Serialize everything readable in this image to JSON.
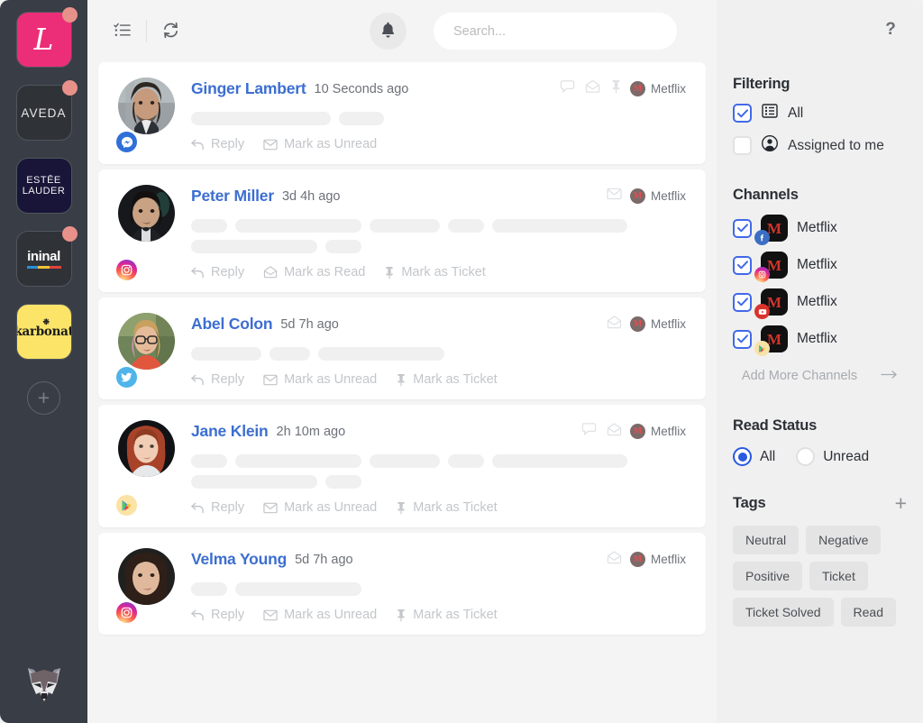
{
  "rail": {
    "brands": [
      {
        "name": "L'Oreal",
        "glyph": "L",
        "type": "loreal",
        "badge": true
      },
      {
        "name": "AVEDA",
        "glyph": "AVEDA",
        "type": "aveda",
        "badge": true
      },
      {
        "name": "Estee Lauder",
        "glyph": "ESTĒE\nLAUDER",
        "line1": "ESTĒE",
        "line2": "LAUDER",
        "type": "estee",
        "badge": false
      },
      {
        "name": "ininal",
        "glyph": "ininal",
        "type": "ininal",
        "badge": true
      },
      {
        "name": "karbonat",
        "glyph": "karbonat",
        "type": "karb",
        "badge": false
      }
    ],
    "add_label": "+",
    "logo_name": "raccoon-logo"
  },
  "topbar": {
    "checklist_icon": "checklist-icon",
    "refresh_icon": "refresh-icon",
    "bell_icon": "bell-icon",
    "search": {
      "value": "",
      "placeholder": "Search..."
    }
  },
  "help": {
    "label": "?"
  },
  "feed": {
    "messages": [
      {
        "sender": "Ginger Lambert",
        "time": "10 Seconds ago",
        "channel": "messenger",
        "avatar": "man-beard-photo",
        "head_icons": [
          "comment-icon",
          "envelope-open-icon",
          "pin-icon"
        ],
        "source": {
          "initial": "M",
          "name": "Metflix"
        },
        "lines": [
          [
            155,
            50
          ]
        ],
        "actions": [
          {
            "icon": "reply-icon",
            "label": "Reply"
          },
          {
            "icon": "envelope-icon",
            "label": "Mark as Unread"
          }
        ]
      },
      {
        "sender": "Peter Miller",
        "time": "3d 4h ago",
        "channel": "instagram",
        "avatar": "young-man-photo",
        "head_icons": [
          "envelope-icon"
        ],
        "source": {
          "initial": "M",
          "name": "Metflix"
        },
        "lines": [
          [
            40,
            140,
            78,
            40,
            150
          ],
          [
            140,
            40
          ]
        ],
        "actions": [
          {
            "icon": "reply-icon",
            "label": "Reply"
          },
          {
            "icon": "envelope-open-icon",
            "label": "Mark as Read"
          },
          {
            "icon": "pin-icon",
            "label": "Mark as Ticket"
          }
        ]
      },
      {
        "sender": "Abel Colon",
        "time": "5d 7h ago",
        "channel": "twitter",
        "avatar": "woman-glasses-photo",
        "head_icons": [
          "envelope-open-icon"
        ],
        "source": {
          "initial": "M",
          "name": "Metflix"
        },
        "lines": [
          [
            78,
            45,
            140
          ]
        ],
        "actions": [
          {
            "icon": "reply-icon",
            "label": "Reply"
          },
          {
            "icon": "envelope-icon",
            "label": "Mark as Unread"
          },
          {
            "icon": "pin-icon",
            "label": "Mark as Ticket"
          }
        ]
      },
      {
        "sender": "Jane Klein",
        "time": "2h 10m ago",
        "channel": "googleplay",
        "avatar": "red-hair-woman-photo",
        "head_icons": [
          "comment-icon",
          "envelope-open-icon"
        ],
        "source": {
          "initial": "M",
          "name": "Metflix"
        },
        "lines": [
          [
            40,
            140,
            78,
            40,
            150
          ],
          [
            140,
            40
          ]
        ],
        "actions": [
          {
            "icon": "reply-icon",
            "label": "Reply"
          },
          {
            "icon": "envelope-icon",
            "label": "Mark as Unread"
          },
          {
            "icon": "pin-icon",
            "label": "Mark as Ticket"
          }
        ]
      },
      {
        "sender": "Velma Young",
        "time": "5d 7h ago",
        "channel": "instagram",
        "avatar": "dark-hair-woman-photo",
        "head_icons": [
          "envelope-open-icon"
        ],
        "source": {
          "initial": "M",
          "name": "Metflix"
        },
        "lines": [
          [
            40,
            140
          ]
        ],
        "actions": [
          {
            "icon": "reply-icon",
            "label": "Reply"
          },
          {
            "icon": "envelope-icon",
            "label": "Mark as Unread"
          },
          {
            "icon": "pin-icon",
            "label": "Mark as Ticket"
          }
        ]
      }
    ]
  },
  "filtering": {
    "title": "Filtering",
    "options": [
      {
        "label": "All",
        "icon": "list-icon",
        "checked": true
      },
      {
        "label": "Assigned to me",
        "icon": "person-icon",
        "checked": false
      }
    ]
  },
  "channels": {
    "title": "Channels",
    "items": [
      {
        "name": "Metflix",
        "initial": "M",
        "network": "facebook",
        "checked": true
      },
      {
        "name": "Metflix",
        "initial": "M",
        "network": "instagram",
        "checked": true
      },
      {
        "name": "Metflix",
        "initial": "M",
        "network": "youtube",
        "checked": true
      },
      {
        "name": "Metflix",
        "initial": "M",
        "network": "googleplay",
        "checked": true
      }
    ],
    "add_label": "Add More Channels",
    "add_icon": "arrow-right-icon"
  },
  "read_status": {
    "title": "Read Status",
    "options": [
      {
        "label": "All",
        "selected": true
      },
      {
        "label": "Unread",
        "selected": false
      }
    ]
  },
  "tags": {
    "title": "Tags",
    "add_icon": "plus-icon",
    "items": [
      "Neutral",
      "Negative",
      "Positive",
      "Ticket",
      "Ticket Solved",
      "Read"
    ]
  },
  "colors": {
    "accent_blue": "#4169e8",
    "sender_blue": "#3c6ed0",
    "rail_bg": "#393d45",
    "panel_bg": "#f0f0f0",
    "card_bg": "#ffffff",
    "badge_dot": "#e8918a"
  }
}
